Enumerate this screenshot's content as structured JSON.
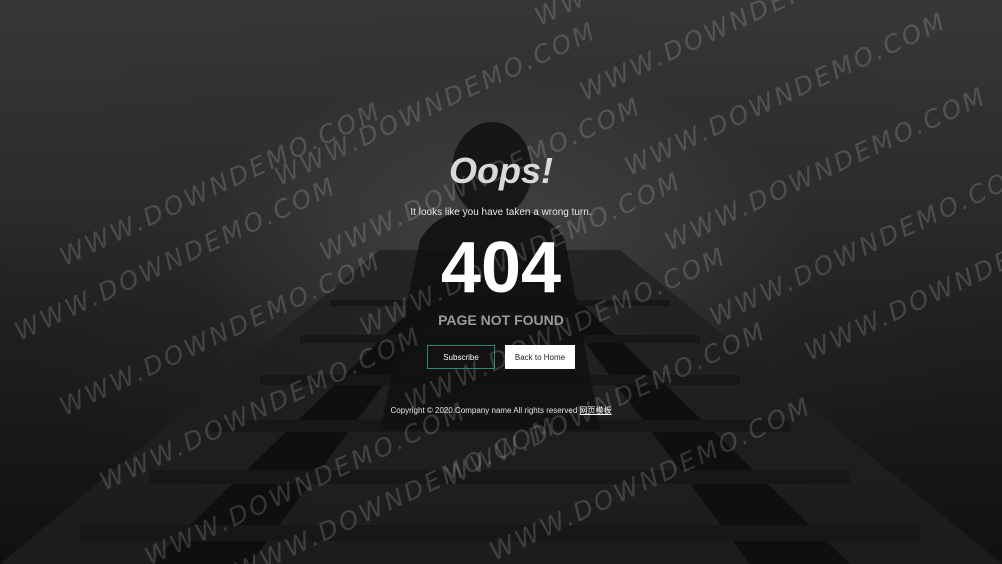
{
  "page": {
    "title": "Oops!",
    "subtitle": "It looks like you have taken a wrong turn.",
    "error_code": "404",
    "error_text": "PAGE NOT FOUND"
  },
  "buttons": {
    "subscribe": "Subscribe",
    "home": "Back to Home"
  },
  "footer": {
    "copyright": "Copyright © 2020.Company name All rights reserved",
    "link": "网页模板"
  },
  "watermark": {
    "text": "WWW.DOWNDEMO.COM"
  },
  "colors": {
    "accent_border": "#2a8a7a",
    "home_button_bg": "#ffffff",
    "error_text": "#9a9a9a"
  }
}
